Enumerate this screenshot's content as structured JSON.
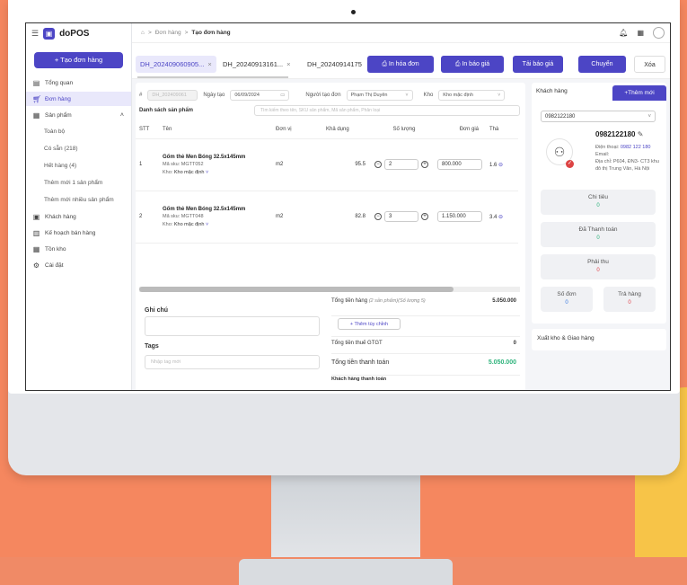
{
  "app": {
    "name": "doPOS",
    "new_order_label": "+ Tạo đơn hàng"
  },
  "breadcrumb": {
    "home": "⌂",
    "sep": ">",
    "level1": "Đơn hàng",
    "level2": "Tạo đơn hàng"
  },
  "sidebar": {
    "items": [
      {
        "label": "Tổng quan",
        "icon": "chart-icon"
      },
      {
        "label": "Đơn hàng",
        "icon": "cart-icon"
      },
      {
        "label": "Sản phẩm",
        "icon": "box-icon"
      },
      {
        "label": "Toàn bộ"
      },
      {
        "label": "Có sẵn (218)"
      },
      {
        "label": "Hết hàng (4)"
      },
      {
        "label": "Thêm mới 1 sản phẩm"
      },
      {
        "label": "Thêm mới nhiều sản phẩm"
      },
      {
        "label": "Khách hàng",
        "icon": "user-icon"
      },
      {
        "label": "Kế hoạch bán hàng",
        "icon": "plan-icon"
      },
      {
        "label": "Tồn kho",
        "icon": "warehouse-icon"
      },
      {
        "label": "Cài đặt",
        "icon": "gear-icon"
      }
    ]
  },
  "tabs": [
    {
      "label": "DH_202409060905...",
      "close": "×"
    },
    {
      "label": "DH_20240913161...",
      "close": "×"
    },
    {
      "label": "DH_20240914175"
    }
  ],
  "actions": {
    "print_order": "In hóa đơn",
    "print_quote": "In báo giá",
    "reload_quote": "Tải báo giá",
    "transfer": "Chuyển",
    "delete": "Xóa"
  },
  "order": {
    "hash": "#",
    "code_placeholder": "DH_202409061",
    "created_label": "Ngày tạo",
    "created_date": "06/09/2024",
    "creator_label": "Người tạo đơn",
    "creator": "Phạm Thị Duyên",
    "warehouse_label": "Kho",
    "warehouse": "Kho mặc định"
  },
  "products": {
    "title": "Danh sách sản phẩm",
    "search_placeholder": "Tìm kiếm theo tên, SKU sản phẩm, Mã sản phẩm, Phân loại",
    "headers": [
      "STT",
      "Tên",
      "Đơn vị",
      "Khả dụng",
      "Số lượng",
      "Đơn giá",
      "Thà"
    ],
    "rows": [
      {
        "stt": "1",
        "name": "Gốm thẻ Men Bóng 32.5x145mm",
        "sku": "Mã sku: MGTT052",
        "wh_label": "Kho:",
        "wh": "Kho mặc định",
        "unit": "m2",
        "available": "95.5",
        "qty": "2",
        "price": "800.000",
        "total": "1.6"
      },
      {
        "stt": "2",
        "name": "Gốm thẻ Men Bóng 32.5x145mm",
        "sku": "Mã sku: MGTT048",
        "wh_label": "Kho:",
        "wh": "Kho mặc định",
        "unit": "m2",
        "available": "82.8",
        "qty": "3",
        "price": "1.150.000",
        "total": "3.4"
      }
    ]
  },
  "notes": {
    "note_label": "Ghi chú",
    "tags_label": "Tags",
    "tags_placeholder": "Nhập tag mới"
  },
  "summary": {
    "goods_label": "Tổng tiền hàng",
    "goods_note": "(2 sản phẩm)(Số lượng 5)",
    "goods_value": "5.050.000",
    "custom_btn": "+ Thêm tùy chỉnh",
    "vat_label": "Tổng tiền thuế GTGT",
    "vat_value": "0",
    "pay_label": "Tổng tiền thanh toán",
    "pay_value": "5.050.000",
    "paid_label": "Khách hàng thanh toán"
  },
  "customer": {
    "tab_label": "Khách hàng",
    "add_label": "+Thêm mới",
    "phone_select": "0982122180",
    "phone": "0982122180",
    "phone_line_label": "Điện thoại:",
    "phone_line": "0982 122 180",
    "email_label": "Email:",
    "address": "Địa chỉ: P604, ĐN3- CT3 khu đô thị Trung Văn, Hà Nội",
    "stats": [
      {
        "label": "Chi tiêu",
        "value": "0",
        "color": "#2db37b"
      },
      {
        "label": "Đã Thanh toán",
        "value": "0",
        "color": "#2db37b"
      },
      {
        "label": "Phải thu",
        "value": "0",
        "color": "#e0434b"
      },
      {
        "label": "Số đơn",
        "value": "0",
        "color": "#3a7be0"
      },
      {
        "label": "Trả hàng",
        "value": "0",
        "color": "#e0434b"
      }
    ]
  },
  "shipping": {
    "label": "Xuất kho & Giao hàng"
  }
}
